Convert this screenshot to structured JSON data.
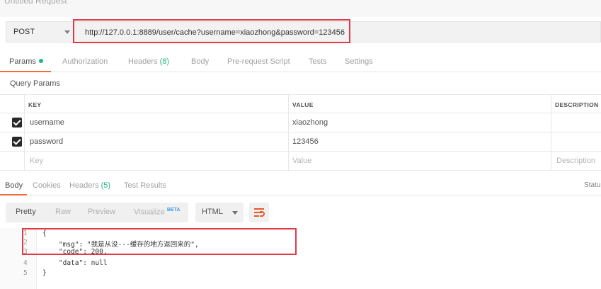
{
  "request": {
    "title": "Untitled Request",
    "method": "POST",
    "url": "http://127.0.0.1:8889/user/cache?username=xiaozhong&password=123456"
  },
  "request_tabs": [
    {
      "label": "Params",
      "count": ""
    },
    {
      "label": "Authorization",
      "count": ""
    },
    {
      "label": "Headers",
      "count": "(8)"
    },
    {
      "label": "Body",
      "count": ""
    },
    {
      "label": "Pre-request Script",
      "count": ""
    },
    {
      "label": "Tests",
      "count": ""
    },
    {
      "label": "Settings",
      "count": ""
    }
  ],
  "query_params": {
    "title": "Query Params",
    "columns": {
      "key": "KEY",
      "value": "VALUE",
      "description": "DESCRIPTION"
    },
    "rows": [
      {
        "key": "username",
        "value": "xiaozhong",
        "checked": true
      },
      {
        "key": "password",
        "value": "123456",
        "checked": true
      }
    ],
    "placeholder": {
      "key": "Key",
      "value": "Value",
      "description": "Description"
    }
  },
  "response_tabs": [
    {
      "label": "Body",
      "count": ""
    },
    {
      "label": "Cookies",
      "count": ""
    },
    {
      "label": "Headers",
      "count": "(5)"
    },
    {
      "label": "Test Results",
      "count": ""
    }
  ],
  "status_label": "Statu",
  "view_modes": {
    "pretty": "Pretty",
    "raw": "Raw",
    "preview": "Preview",
    "visualize": "Visualize",
    "beta": "BETA"
  },
  "format": "HTML",
  "code_lines": [
    {
      "n": "1",
      "text": "{"
    },
    {
      "n": "2",
      "text": "    \"msg\": \"我是从没---缓存的地方返回来的\","
    },
    {
      "n": "3",
      "text": "    \"code\": 200,"
    },
    {
      "n": "4",
      "text": "    \"data\": null"
    },
    {
      "n": "5",
      "text": "}"
    }
  ],
  "colors": {
    "accent": "#f26b3a",
    "green": "#26b47f",
    "highlight": "#e13a46"
  }
}
